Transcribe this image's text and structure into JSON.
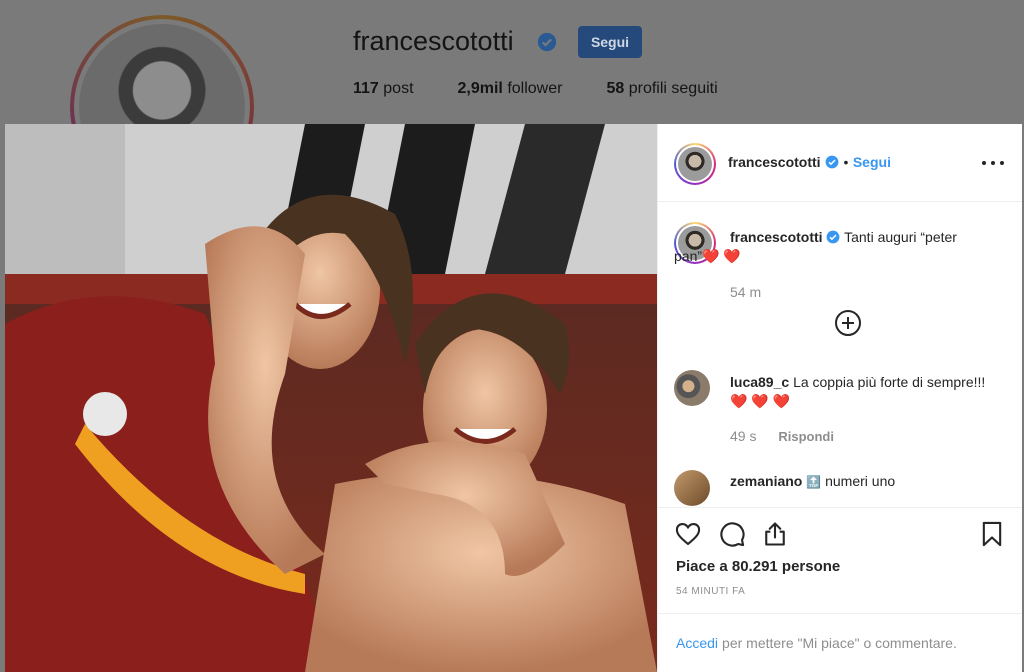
{
  "profile": {
    "username": "francescototti",
    "follow_button": "Segui",
    "stats": {
      "posts_count": "117",
      "posts_label": "post",
      "followers_count": "2,9mil",
      "followers_label": "follower",
      "following_count": "58",
      "following_label": "profili seguiti"
    }
  },
  "post": {
    "header": {
      "username": "francescototti",
      "separator": "•",
      "follow_label": "Segui"
    },
    "caption": {
      "username": "francescototti",
      "text": "Tanti auguri “peter pan”",
      "hearts": "❤️ ❤️",
      "time": "54 m"
    },
    "comments": [
      {
        "username": "luca89_c",
        "text": "La coppia più forte di sempre!!!",
        "hearts": "❤️ ❤️ ❤️",
        "time": "49 s",
        "reply_label": "Rispondi"
      },
      {
        "username": "zemaniano",
        "badge": "🔝",
        "text": "numeri uno"
      }
    ],
    "likes_text": "Piace a 80.291 persone",
    "timestamp": "54 MINUTI FA",
    "login_prompt": {
      "link": "Accedi",
      "text": "per mettere \"Mi piace\" o commentare."
    }
  },
  "colors": {
    "link_blue": "#3897f0",
    "heart_red": "#e0202f",
    "roma_red": "#8a1f1c",
    "roma_gold": "#f0a020"
  },
  "icons": [
    "verified-icon",
    "more-options-icon",
    "add-comment-icon",
    "heart-icon",
    "comment-icon",
    "share-icon",
    "bookmark-icon"
  ]
}
